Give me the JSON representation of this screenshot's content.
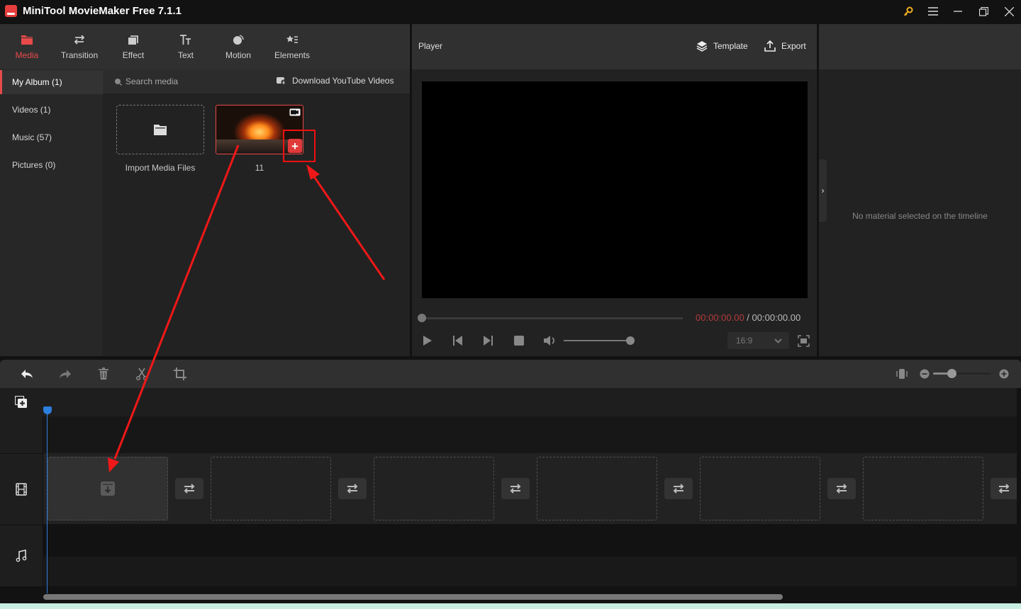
{
  "window": {
    "title": "MiniTool MovieMaker Free 7.1.1",
    "controls": [
      "key-icon",
      "menu-icon",
      "minimize-icon",
      "maximize-icon",
      "close-icon"
    ]
  },
  "toolbar": {
    "tabs": [
      {
        "label": "Media",
        "icon": "folder-icon",
        "active": true
      },
      {
        "label": "Transition",
        "icon": "swap-icon",
        "active": false
      },
      {
        "label": "Effect",
        "icon": "effect-icon",
        "active": false
      },
      {
        "label": "Text",
        "icon": "text-icon",
        "active": false
      },
      {
        "label": "Motion",
        "icon": "motion-icon",
        "active": false
      },
      {
        "label": "Elements",
        "icon": "elements-icon",
        "active": false
      }
    ]
  },
  "sidebar": {
    "items": [
      {
        "label": "My Album (1)",
        "active": true
      },
      {
        "label": "Videos (1)",
        "active": false
      },
      {
        "label": "Music (57)",
        "active": false
      },
      {
        "label": "Pictures (0)",
        "active": false
      }
    ]
  },
  "media": {
    "search_placeholder": "Search media",
    "download_label": "Download YouTube Videos",
    "import_label": "Import Media Files",
    "clips": [
      {
        "label": "11",
        "type": "video",
        "add_symbol": "+"
      }
    ]
  },
  "player": {
    "title": "Player",
    "template_label": "Template",
    "export_label": "Export",
    "current_time": "00:00:00.00",
    "separator": " / ",
    "total_time": "00:00:00.00",
    "progress": 0,
    "volume": 1.0,
    "aspect_ratio": "16:9"
  },
  "properties": {
    "empty_message": "No material selected on the timeline",
    "collapse_symbol": "›"
  },
  "timeline": {
    "zoom_level": 0.35,
    "video_slots": 6,
    "transition_slots": 6
  },
  "colors": {
    "accent": "#e84a4a",
    "playhead": "#2d7fe0",
    "timecode_current": "#b33a3a"
  }
}
